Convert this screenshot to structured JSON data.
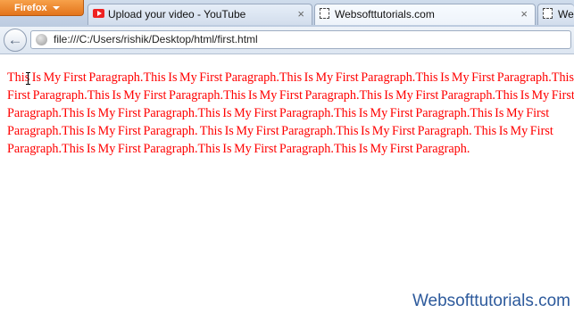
{
  "browser": {
    "menu_button_label": "Firefox",
    "tabs": [
      {
        "title": "Upload your video - YouTube",
        "favicon": "youtube-icon",
        "close": "×"
      },
      {
        "title": "Websofttutorials.com",
        "favicon": "page-icon",
        "close": "×"
      },
      {
        "title": "We",
        "favicon": "page-icon"
      }
    ],
    "back_glyph": "←",
    "url": "file:///C:/Users/rishik/Desktop/html/first.html"
  },
  "page": {
    "paragraph": "This Is My First Paragraph.This Is My First Paragraph.This Is My First Paragraph.This Is My First Paragraph.This Is My First Paragraph.This Is My First Paragraph.This Is My First Paragraph.This Is My First Paragraph.This Is My First Paragraph.This Is My First Paragraph.This Is My First Paragraph.This Is My First Paragraph.This Is My First Paragraph.This Is My First Paragraph. This Is My First Paragraph.This Is My First Paragraph. This Is My First Paragraph.This Is My First Paragraph.This Is My First Paragraph.This Is My First Paragraph.",
    "text_color": "#ff0000"
  },
  "watermark": "Websofttutorials.com"
}
